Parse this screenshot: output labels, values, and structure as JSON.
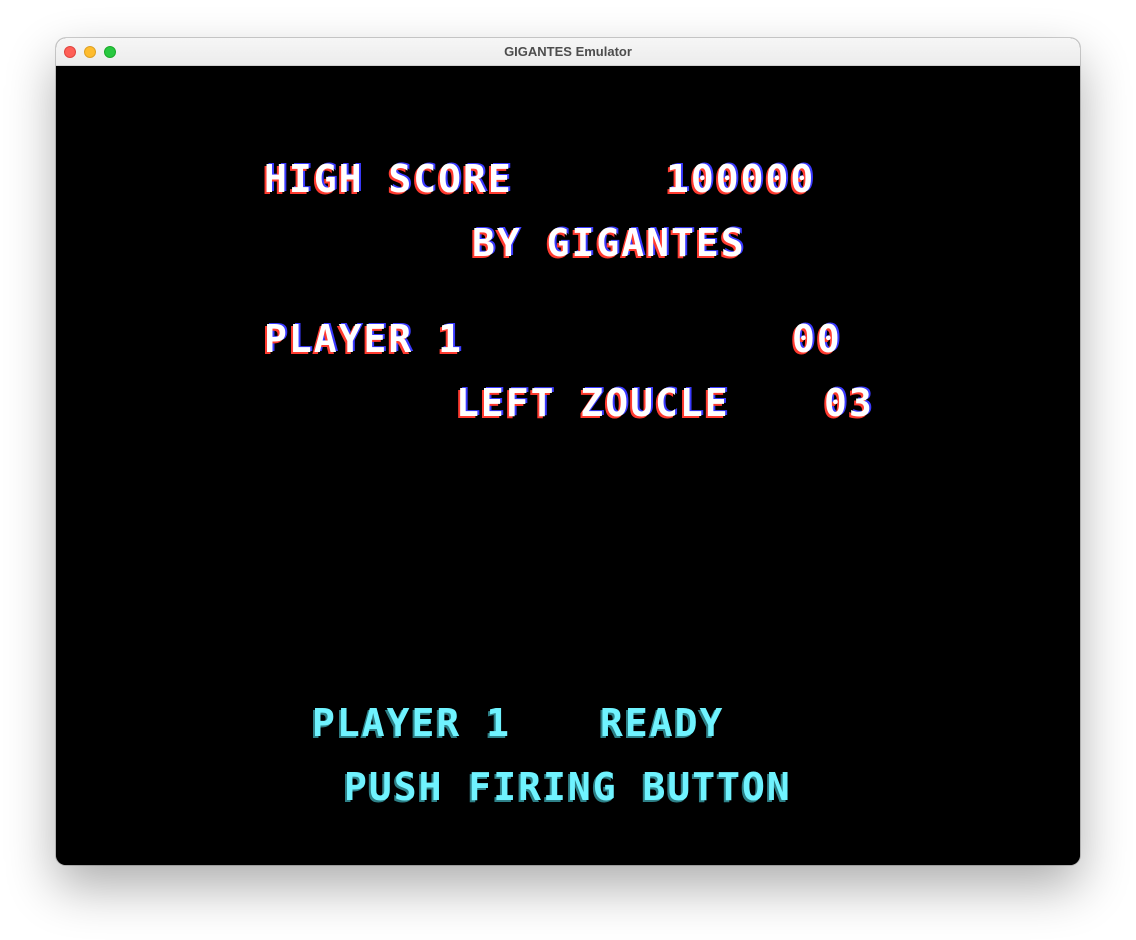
{
  "window": {
    "title": "GIGANTES Emulator"
  },
  "attract_screen": {
    "high_score_label": "HIGH SCORE",
    "high_score_value": "100000",
    "high_score_holder": "BY GIGANTES",
    "player_label": "PLAYER 1",
    "player_score": "00",
    "lives_label": "LEFT ZOUCLE",
    "lives_value": "03",
    "ready_player": "PLAYER 1",
    "ready_text": "READY",
    "prompt": "PUSH FIRING BUTTON"
  },
  "colors": {
    "background": "#000000",
    "text_primary": "#ffffff",
    "text_prompt": "#6ff3ff",
    "shadow_red": "#ff3b30",
    "shadow_blue": "#3a3aff"
  }
}
